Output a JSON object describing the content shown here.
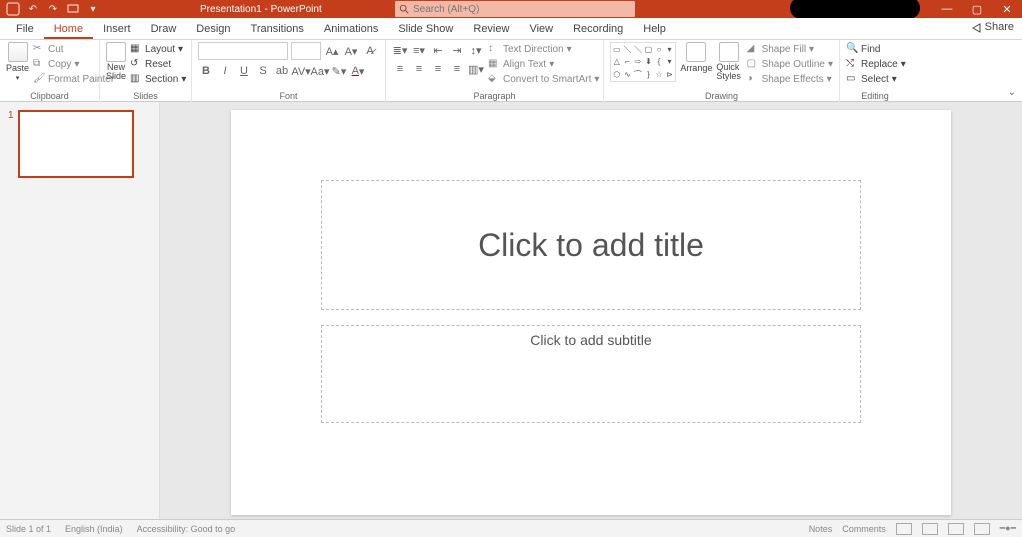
{
  "titlebar": {
    "doc_title": "Presentation1 - PowerPoint",
    "search_placeholder": "Search (Alt+Q)"
  },
  "tabs": {
    "items": [
      "File",
      "Home",
      "Insert",
      "Draw",
      "Design",
      "Transitions",
      "Animations",
      "Slide Show",
      "Review",
      "View",
      "Recording",
      "Help"
    ],
    "active": "Home",
    "share": "Share"
  },
  "ribbon": {
    "clipboard": {
      "label": "Clipboard",
      "paste": "Paste",
      "cut": "Cut",
      "copy": "Copy",
      "format_painter": "Format Painter"
    },
    "slides": {
      "label": "Slides",
      "new_slide": "New Slide",
      "layout": "Layout",
      "reset": "Reset",
      "section": "Section"
    },
    "font": {
      "label": "Font"
    },
    "paragraph": {
      "label": "Paragraph",
      "text_direction": "Text Direction",
      "align_text": "Align Text",
      "smartart": "Convert to SmartArt"
    },
    "drawing": {
      "label": "Drawing",
      "arrange": "Arrange",
      "quick_styles": "Quick Styles",
      "shape_fill": "Shape Fill",
      "shape_outline": "Shape Outline",
      "shape_effects": "Shape Effects"
    },
    "editing": {
      "label": "Editing",
      "find": "Find",
      "replace": "Replace",
      "select": "Select"
    }
  },
  "slide": {
    "thumb_number": "1",
    "title_placeholder": "Click to add title",
    "subtitle_placeholder": "Click to add subtitle"
  },
  "status": {
    "slide_indicator": "Slide 1 of 1",
    "language": "English (India)",
    "accessibility": "Accessibility: Good to go",
    "notes": "Notes",
    "comments": "Comments"
  }
}
